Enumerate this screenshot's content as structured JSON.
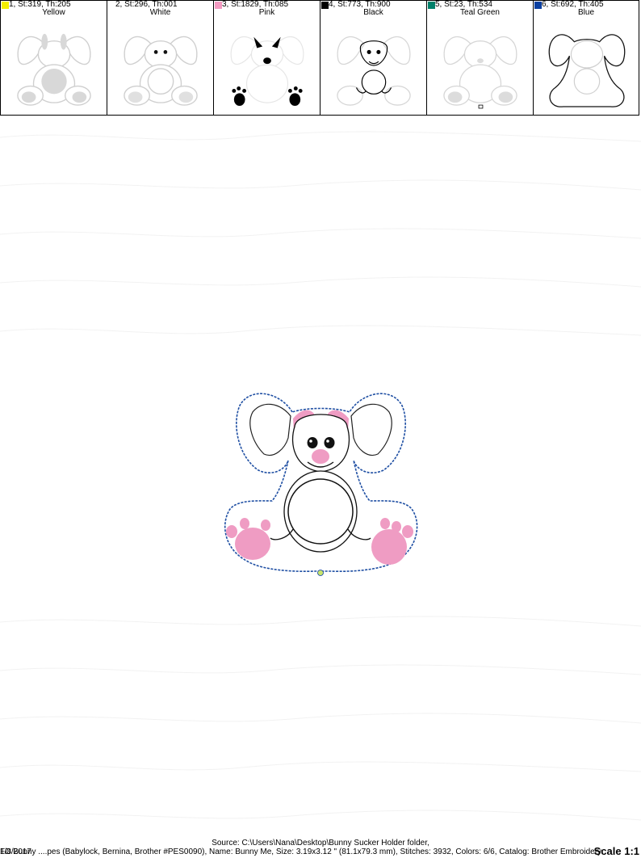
{
  "colors": [
    {
      "stats": "1, St:319, Th:205",
      "name": "Yellow",
      "swatch": "#f4f000"
    },
    {
      "stats": "2, St:296, Th:001",
      "name": "White",
      "swatch": "#ffffff"
    },
    {
      "stats": "3, St:1829, Th:085",
      "name": "Pink",
      "swatch": "#f39ac1"
    },
    {
      "stats": "4, St:773, Th:900",
      "name": "Black",
      "swatch": "#000000"
    },
    {
      "stats": "5, St:23, Th:534",
      "name": "Teal Green",
      "swatch": "#00806a"
    },
    {
      "stats": "6, St:692, Th:405",
      "name": "Blue",
      "swatch": "#0a3fa0"
    }
  ],
  "footer": {
    "source": "Source: C:\\Users\\Nana\\Desktop\\Bunny Sucker Holder folder,",
    "date": "1/8/2017",
    "info": "FD Bunny ....pes (Babylock, Bernina, Brother #PES0090), Name: Bunny Me, Size: 3.19x3.12 \" (81.1x79.3 mm), Stitches: 3932, Colors: 6/6, Catalog: Brother Embroidery",
    "scale": "Scale 1:1"
  }
}
